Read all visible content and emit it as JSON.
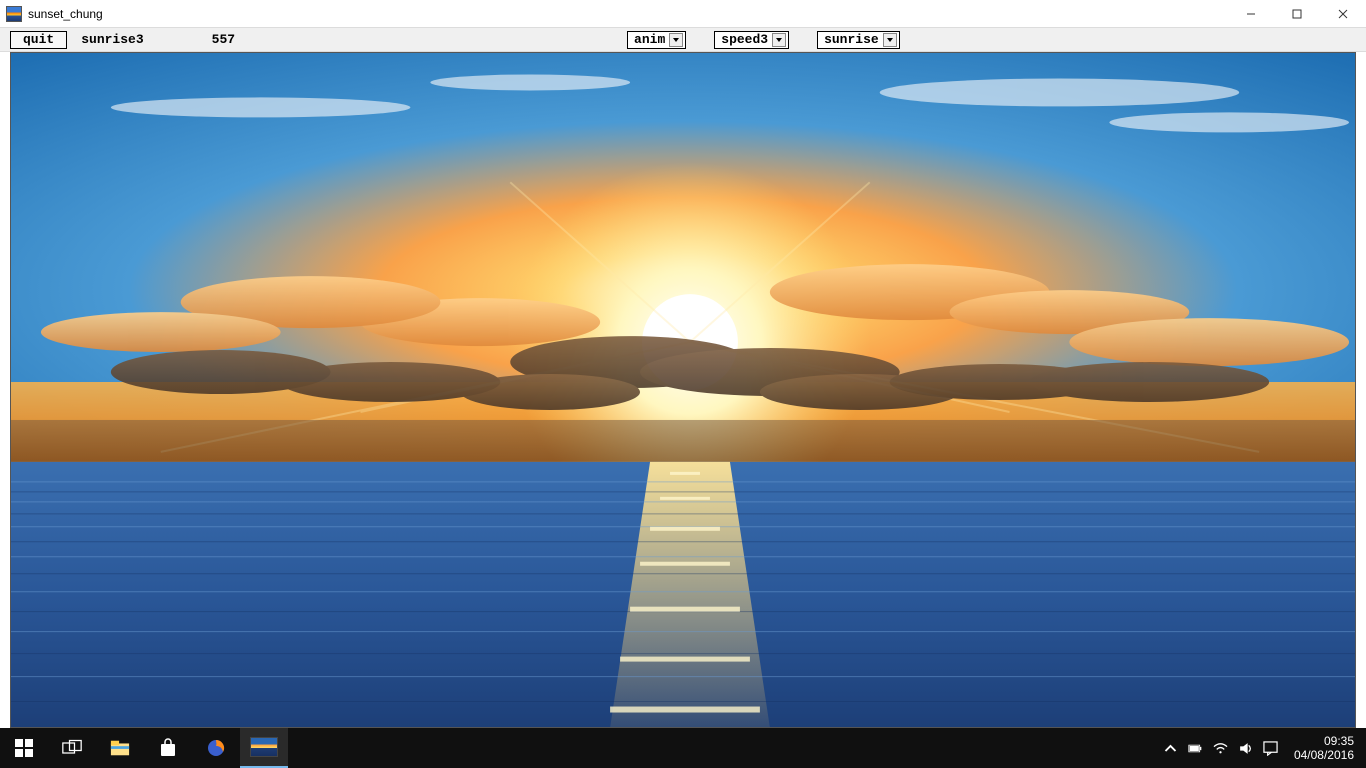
{
  "window": {
    "title": "sunset_chung"
  },
  "toolbar": {
    "quit_label": "quit",
    "preset_label": "sunrise3",
    "counter": "557",
    "anim_select": "anim",
    "speed_select": "speed3",
    "scene_select": "sunrise"
  },
  "taskbar": {
    "clock_time": "09:35",
    "clock_date": "04/08/2016"
  }
}
